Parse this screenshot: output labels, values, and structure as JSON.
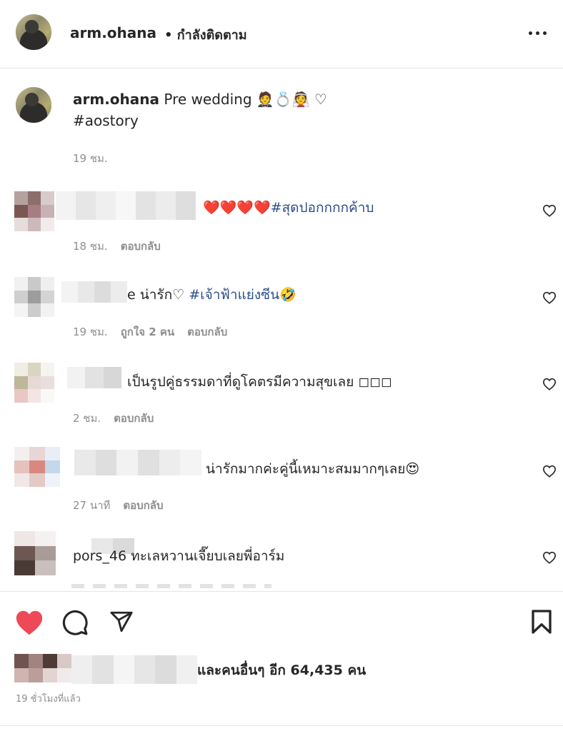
{
  "post_header": {
    "username": "arm.ohana",
    "follow_status": "• กำลังติดตาม",
    "more_icon": "more-horizontal-icon"
  },
  "caption": {
    "username": "arm.ohana",
    "text": "Pre wedding 🤵💍👰 ♡",
    "hashtag": "#aostory",
    "time": "19 ชม."
  },
  "comments": [
    {
      "text_suffix": "❤️❤️❤️❤️",
      "hashtag": "#สุดปอกกกกค้าบ",
      "time": "18 ชม.",
      "likes": "",
      "reply": "ตอบกลับ"
    },
    {
      "text_suffix": "e น่ารัก♡",
      "hashtag": "#เจ้าฟ้าแย่งซีน🤣",
      "time": "19 ชม.",
      "likes": "ถูกใจ 2 คน",
      "reply": "ตอบกลับ"
    },
    {
      "text_suffix": "เป็นรูปคู่ธรรมดาที่ดูโคตรมีความสุขเลย ◻◻◻",
      "hashtag": "",
      "time": "2 ชม.",
      "likes": "",
      "reply": "ตอบกลับ"
    },
    {
      "text_suffix": "น่ารักมากค่ะคู่นี้เหมาะสมมากๆเลย😍",
      "hashtag": "",
      "time": "27 นาที",
      "likes": "",
      "reply": "ตอบกลับ"
    },
    {
      "text_suffix": "pors_46 ทะเลหวานเจี๊ยบเลยพี่อาร์ม",
      "hashtag": "",
      "time": "",
      "likes": "",
      "reply": ""
    }
  ],
  "actions": {
    "like_icon": "heart-filled-icon",
    "comment_icon": "comment-icon",
    "share_icon": "send-icon",
    "save_icon": "bookmark-icon",
    "like_color": "#ed4956"
  },
  "likes_summary": "และคนอื่นๆ อีก 64,435 คน",
  "posted_ago": "19 ชั่วโมงที่แล้ว"
}
